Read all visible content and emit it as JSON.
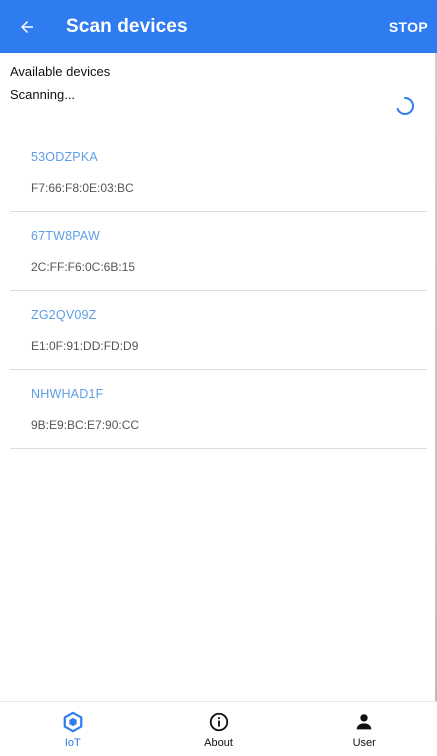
{
  "appbar": {
    "title": "Scan devices",
    "back_icon": "arrow-left-icon",
    "stop_label": "STOP",
    "color": "#2f7bf0"
  },
  "status": {
    "heading": "Available devices",
    "scanning": "Scanning...",
    "spinner_icon": "loading-spinner-icon"
  },
  "devices": [
    {
      "name": "53ODZPKA",
      "mac": "F7:66:F8:0E:03:BC"
    },
    {
      "name": "67TW8PAW",
      "mac": "2C:FF:F6:0C:6B:15"
    },
    {
      "name": "ZG2QV09Z",
      "mac": "E1:0F:91:DD:FD:D9"
    },
    {
      "name": "NHWHAD1F",
      "mac": "9B:E9:BC:E7:90:CC"
    }
  ],
  "bottom_nav": [
    {
      "label": "IoT",
      "icon": "iot-hexagon-icon",
      "active": true
    },
    {
      "label": "About",
      "icon": "info-circle-icon",
      "active": false
    },
    {
      "label": "User",
      "icon": "person-icon",
      "active": false
    }
  ],
  "colors": {
    "accent": "#2f7bf0",
    "device_name": "#5d9ee6",
    "divider": "#dcdcdc"
  }
}
